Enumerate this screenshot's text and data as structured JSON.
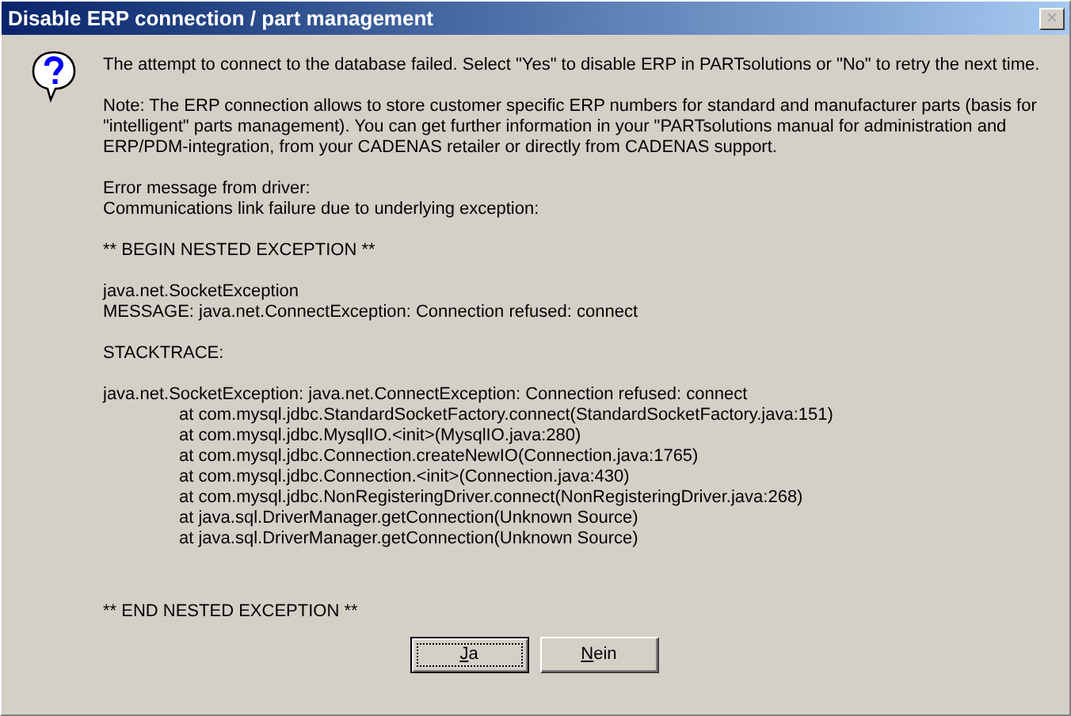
{
  "window": {
    "title": "Disable ERP connection / part management",
    "close_button": "×"
  },
  "message_blocks": [
    {
      "kind": "paragraph",
      "lines": [
        {
          "text": "The attempt to connect to the database failed. Select \"Yes\" to disable ERP in PARTsolutions or \"No\" to retry the next time.",
          "indented": false
        }
      ]
    },
    {
      "kind": "paragraph",
      "lines": [
        {
          "text": "Note: The ERP connection allows to store customer specific ERP numbers for standard and manufacturer parts (basis for",
          "indented": false
        },
        {
          "text": "\"intelligent\" parts management). You can get further information in your \"PARTsolutions manual for administration and",
          "indented": false
        },
        {
          "text": "ERP/PDM-integration, from your CADENAS retailer or directly from CADENAS support.",
          "indented": false
        }
      ]
    },
    {
      "kind": "paragraph",
      "lines": [
        {
          "text": "Error message from driver:",
          "indented": false
        },
        {
          "text": "Communications link failure due to underlying exception:",
          "indented": false
        }
      ]
    },
    {
      "kind": "paragraph",
      "lines": [
        {
          "text": "** BEGIN NESTED EXCEPTION **",
          "indented": false
        }
      ]
    },
    {
      "kind": "paragraph",
      "lines": [
        {
          "text": "java.net.SocketException",
          "indented": false
        },
        {
          "text": "MESSAGE: java.net.ConnectException: Connection refused: connect",
          "indented": false
        }
      ]
    },
    {
      "kind": "paragraph",
      "lines": [
        {
          "text": "STACKTRACE:",
          "indented": false
        }
      ]
    },
    {
      "kind": "paragraph",
      "lines": [
        {
          "text": "java.net.SocketException: java.net.ConnectException: Connection refused: connect",
          "indented": false
        },
        {
          "text": "at com.mysql.jdbc.StandardSocketFactory.connect(StandardSocketFactory.java:151)",
          "indented": true
        },
        {
          "text": "at com.mysql.jdbc.MysqlIO.<init>(MysqlIO.java:280)",
          "indented": true
        },
        {
          "text": "at com.mysql.jdbc.Connection.createNewIO(Connection.java:1765)",
          "indented": true
        },
        {
          "text": "at com.mysql.jdbc.Connection.<init>(Connection.java:430)",
          "indented": true
        },
        {
          "text": "at com.mysql.jdbc.NonRegisteringDriver.connect(NonRegisteringDriver.java:268)",
          "indented": true
        },
        {
          "text": "at java.sql.DriverManager.getConnection(Unknown Source)",
          "indented": true
        },
        {
          "text": "at java.sql.DriverManager.getConnection(Unknown Source)",
          "indented": true
        }
      ]
    },
    {
      "kind": "trailer",
      "lines": [
        {
          "text": "** END NESTED EXCEPTION **",
          "indented": false
        }
      ]
    }
  ],
  "buttons": [
    {
      "label": "Ja",
      "default": true
    },
    {
      "label": "Nein",
      "default": false
    }
  ]
}
